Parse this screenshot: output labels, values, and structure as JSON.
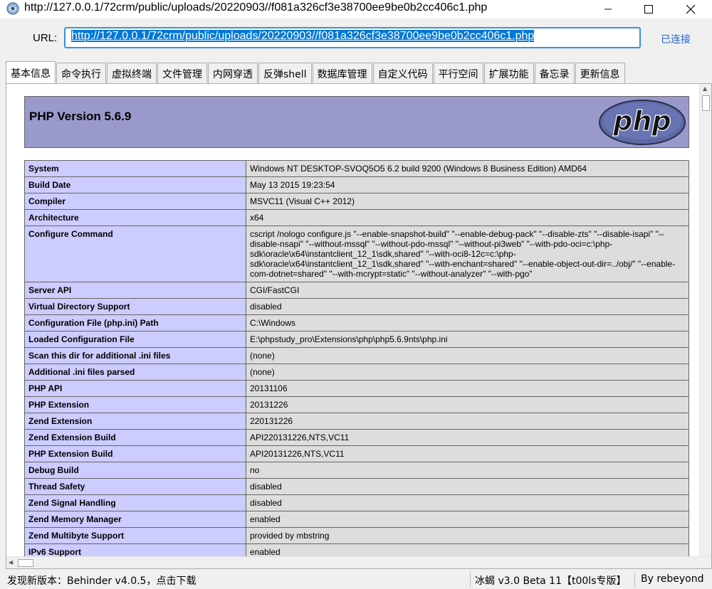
{
  "window": {
    "title": "http://127.0.0.1/72crm/public/uploads/20220903//f081a326cf3e38700ee9be0b2cc406c1.php"
  },
  "urlbar": {
    "label": "URL:",
    "value": "http://127.0.0.1/72crm/public/uploads/20220903//f081a326cf3e38700ee9be0b2cc406c1.php",
    "status": "已连接"
  },
  "tabs": [
    "基本信息",
    "命令执行",
    "虚拟终端",
    "文件管理",
    "内网穿透",
    "反弹shell",
    "数据库管理",
    "自定义代码",
    "平行空间",
    "扩展功能",
    "备忘录",
    "更新信息"
  ],
  "active_tab": "基本信息",
  "phpinfo": {
    "title": "PHP Version 5.6.9",
    "logo_text": "php",
    "rows": [
      {
        "k": "System",
        "v": "Windows NT DESKTOP-SVOQ5O5 6.2 build 9200 (Windows 8 Business Edition) AMD64"
      },
      {
        "k": "Build Date",
        "v": "May 13 2015 19:23:54"
      },
      {
        "k": "Compiler",
        "v": "MSVC11 (Visual C++ 2012)"
      },
      {
        "k": "Architecture",
        "v": "x64"
      },
      {
        "k": "Configure Command",
        "v": "cscript /nologo configure.js \"--enable-snapshot-build\" \"--enable-debug-pack\" \"--disable-zts\" \"--disable-isapi\" \"--disable-nsapi\" \"--without-mssql\" \"--without-pdo-mssql\" \"--without-pi3web\" \"--with-pdo-oci=c:\\php-sdk\\oracle\\x64\\instantclient_12_1\\sdk,shared\" \"--with-oci8-12c=c:\\php-sdk\\oracle\\x64\\instantclient_12_1\\sdk,shared\" \"--with-enchant=shared\" \"--enable-object-out-dir=../obj/\" \"--enable-com-dotnet=shared\" \"--with-mcrypt=static\" \"--without-analyzer\" \"--with-pgo\""
      },
      {
        "k": "Server API",
        "v": "CGI/FastCGI"
      },
      {
        "k": "Virtual Directory Support",
        "v": "disabled"
      },
      {
        "k": "Configuration File (php.ini) Path",
        "v": "C:\\Windows"
      },
      {
        "k": "Loaded Configuration File",
        "v": "E:\\phpstudy_pro\\Extensions\\php\\php5.6.9nts\\php.ini"
      },
      {
        "k": "Scan this dir for additional .ini files",
        "v": "(none)"
      },
      {
        "k": "Additional .ini files parsed",
        "v": "(none)"
      },
      {
        "k": "PHP API",
        "v": "20131106"
      },
      {
        "k": "PHP Extension",
        "v": "20131226"
      },
      {
        "k": "Zend Extension",
        "v": "220131226"
      },
      {
        "k": "Zend Extension Build",
        "v": "API220131226,NTS,VC11"
      },
      {
        "k": "PHP Extension Build",
        "v": "API20131226,NTS,VC11"
      },
      {
        "k": "Debug Build",
        "v": "no"
      },
      {
        "k": "Thread Safety",
        "v": "disabled"
      },
      {
        "k": "Zend Signal Handling",
        "v": "disabled"
      },
      {
        "k": "Zend Memory Manager",
        "v": "enabled"
      },
      {
        "k": "Zend Multibyte Support",
        "v": "provided by mbstring"
      },
      {
        "k": "IPv6 Support",
        "v": "enabled"
      }
    ]
  },
  "statusbar": {
    "left": "发现新版本：Behinder v4.0.5，点击下载",
    "middle": "冰蝎 v3.0 Beta 11【t00ls专版】",
    "right": "By rebeyond"
  },
  "colors": {
    "accent": "#0078d7",
    "php_header": "#9999cc",
    "key_cell": "#ccccff",
    "value_cell": "#dddddd",
    "link": "#1f5fcf"
  }
}
